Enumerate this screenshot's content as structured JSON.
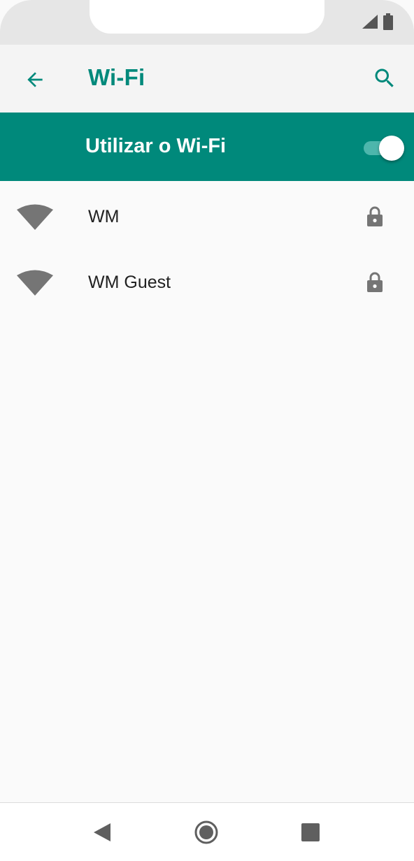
{
  "status_bar": {
    "signal_icon": "cell-signal-icon",
    "battery_icon": "battery-icon"
  },
  "app_bar": {
    "back_icon": "arrow-back-icon",
    "title": "Wi-Fi",
    "search_icon": "search-icon"
  },
  "master_switch": {
    "label": "Utilizar o Wi-Fi",
    "enabled": true
  },
  "networks": [
    {
      "name": "WM",
      "icon": "wifi-signal-icon",
      "secured": true
    },
    {
      "name": "WM Guest",
      "icon": "wifi-signal-icon",
      "secured": true
    }
  ],
  "nav_bar": {
    "back_icon": "nav-back-icon",
    "home_icon": "nav-home-icon",
    "recents_icon": "nav-recents-icon"
  },
  "colors": {
    "accent": "#00897b",
    "accent_light": "#4db6ac",
    "icon_gray": "#757575"
  }
}
